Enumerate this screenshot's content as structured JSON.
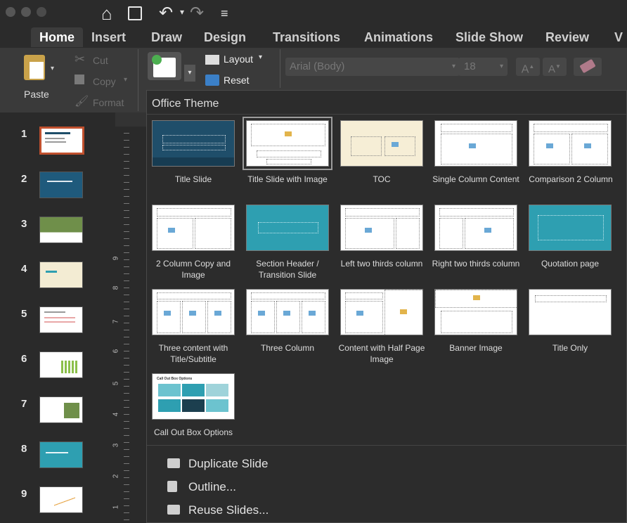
{
  "toolbar": {
    "up_icon": "home-icon",
    "save_icon": "save-icon",
    "undo_icon": "undo-icon",
    "redo_icon": "redo-icon",
    "more_icon": "customize-icon"
  },
  "tabs": [
    "Home",
    "Insert",
    "Draw",
    "Design",
    "Transitions",
    "Animations",
    "Slide Show",
    "Review",
    "V"
  ],
  "clipboard": {
    "paste": "Paste",
    "cut": "Cut",
    "copy": "Copy",
    "format": "Format"
  },
  "slides_group": {
    "layout": "Layout",
    "reset": "Reset"
  },
  "font": {
    "name": "Arial (Body)",
    "size": "18"
  },
  "panel": {
    "title": "Office Theme",
    "layouts": [
      "Title Slide",
      "Title Slide with Image",
      "TOC",
      "Single Column Content",
      "Comparison 2 Column",
      "2 Column Copy and Image",
      "Section Header / Transition Slide",
      "Left two thirds column",
      "Right two thirds column",
      "Quotation page",
      "Three content with Title/Subtitle",
      "Three Column",
      "Content with Half Page Image",
      "Banner Image",
      "Title Only",
      "Call Out Box Options"
    ],
    "callout_heading": "Call Out Box Options",
    "commands": [
      "Duplicate Slide",
      "Outline...",
      "Reuse Slides..."
    ]
  },
  "slide_numbers": [
    "1",
    "2",
    "3",
    "4",
    "5",
    "6",
    "7",
    "8",
    "9"
  ],
  "ruler_numbers": [
    "9",
    "8",
    "7",
    "6",
    "5",
    "4",
    "3",
    "2",
    "1"
  ],
  "colors": {
    "accent": "#2e9fb1",
    "dark_blue": "#1f4e6a",
    "selection": "#c0502e"
  }
}
